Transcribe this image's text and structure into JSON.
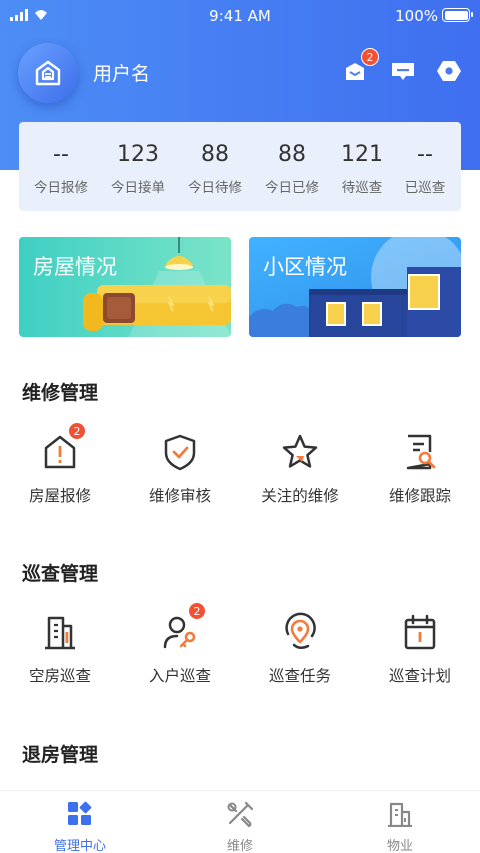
{
  "status_bar": {
    "time": "9:41 AM",
    "battery": "100%"
  },
  "header": {
    "username": "用户名",
    "mail_badge": "2"
  },
  "stats": [
    {
      "value": "--",
      "label": "今日报修"
    },
    {
      "value": "123",
      "label": "今日接单"
    },
    {
      "value": "88",
      "label": "今日待修"
    },
    {
      "value": "88",
      "label": "今日已修"
    },
    {
      "value": "121",
      "label": "待巡查"
    },
    {
      "value": "--",
      "label": "已巡查"
    }
  ],
  "banners": {
    "house": "房屋情况",
    "community": "小区情况"
  },
  "repair": {
    "title": "维修管理",
    "items": [
      {
        "label": "房屋报修",
        "badge": "2",
        "icon": "house-alert-icon"
      },
      {
        "label": "维修审核",
        "icon": "shield-check-icon"
      },
      {
        "label": "关注的维修",
        "icon": "star-icon"
      },
      {
        "label": "维修跟踪",
        "icon": "document-search-icon"
      }
    ]
  },
  "inspection": {
    "title": "巡查管理",
    "items": [
      {
        "label": "空房巡查",
        "icon": "building-icon"
      },
      {
        "label": "入户巡查",
        "badge": "2",
        "icon": "user-key-icon"
      },
      {
        "label": "巡查任务",
        "icon": "location-pin-icon"
      },
      {
        "label": "巡查计划",
        "icon": "calendar-icon"
      }
    ]
  },
  "checkout": {
    "title": "退房管理"
  },
  "tabs": [
    {
      "label": "管理中心",
      "icon": "dashboard-icon",
      "active": true
    },
    {
      "label": "维修",
      "icon": "tools-icon"
    },
    {
      "label": "物业",
      "icon": "property-building-icon"
    }
  ],
  "colors": {
    "primary": "#3e6fee",
    "accent": "#f37b3b",
    "badge": "#f35134"
  }
}
